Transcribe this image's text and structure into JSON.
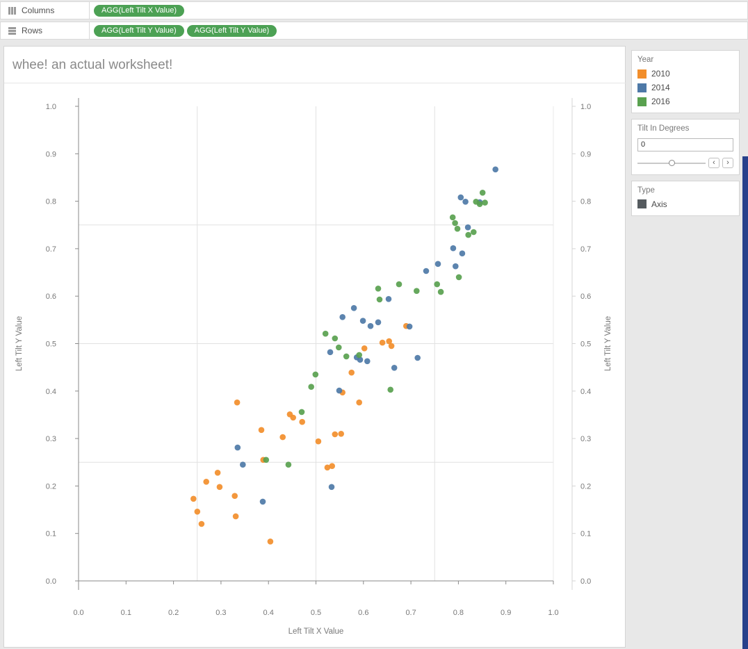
{
  "shelves": {
    "columns": {
      "label": "Columns",
      "pills": [
        "AGG(Left Tilt X Value)"
      ]
    },
    "rows": {
      "label": "Rows",
      "pills": [
        "AGG(Left Tilt Y Value)",
        "AGG(Left Tilt Y Value)"
      ]
    }
  },
  "worksheet": {
    "title": "whee! an actual worksheet!"
  },
  "cards": {
    "year": {
      "title": "Year",
      "items": [
        {
          "label": "2010",
          "color": "#f28e2b"
        },
        {
          "label": "2014",
          "color": "#4e79a7"
        },
        {
          "label": "2016",
          "color": "#59a14f"
        }
      ]
    },
    "tilt": {
      "title": "Tilt In Degrees",
      "value": "0",
      "prev_label": "‹",
      "next_label": "›"
    },
    "type": {
      "title": "Type",
      "items": [
        {
          "label": "Axis",
          "color": "#555b5f"
        }
      ]
    }
  },
  "chart_data": {
    "type": "scatter",
    "title": "whee! an actual worksheet!",
    "xlabel": "Left Tilt X Value",
    "ylabel": "Left Tilt Y Value",
    "ylabel_right": "Left Tilt Y Value",
    "xlim": [
      0.0,
      1.0
    ],
    "ylim": [
      0.0,
      1.0
    ],
    "x_ticks": [
      0.0,
      0.1,
      0.2,
      0.3,
      0.4,
      0.5,
      0.6,
      0.7,
      0.8,
      0.9,
      1.0
    ],
    "y_ticks": [
      0.0,
      0.1,
      0.2,
      0.3,
      0.4,
      0.5,
      0.6,
      0.7,
      0.8,
      0.9,
      1.0
    ],
    "grid_values": [
      0.25,
      0.5,
      0.75
    ],
    "legend_position": "right",
    "series": [
      {
        "name": "2010",
        "color": "#f28e2b",
        "points": [
          [
            0.242,
            0.173
          ],
          [
            0.25,
            0.146
          ],
          [
            0.259,
            0.12
          ],
          [
            0.269,
            0.209
          ],
          [
            0.293,
            0.228
          ],
          [
            0.297,
            0.198
          ],
          [
            0.329,
            0.179
          ],
          [
            0.331,
            0.136
          ],
          [
            0.334,
            0.376
          ],
          [
            0.385,
            0.318
          ],
          [
            0.389,
            0.255
          ],
          [
            0.404,
            0.083
          ],
          [
            0.43,
            0.303
          ],
          [
            0.445,
            0.351
          ],
          [
            0.452,
            0.344
          ],
          [
            0.471,
            0.335
          ],
          [
            0.505,
            0.294
          ],
          [
            0.524,
            0.239
          ],
          [
            0.534,
            0.242
          ],
          [
            0.54,
            0.309
          ],
          [
            0.553,
            0.31
          ],
          [
            0.556,
            0.397
          ],
          [
            0.575,
            0.439
          ],
          [
            0.591,
            0.376
          ],
          [
            0.602,
            0.49
          ],
          [
            0.64,
            0.502
          ],
          [
            0.654,
            0.505
          ],
          [
            0.659,
            0.495
          ],
          [
            0.69,
            0.537
          ]
        ]
      },
      {
        "name": "2014",
        "color": "#4e79a7",
        "points": [
          [
            0.335,
            0.281
          ],
          [
            0.346,
            0.245
          ],
          [
            0.388,
            0.167
          ],
          [
            0.533,
            0.198
          ],
          [
            0.53,
            0.482
          ],
          [
            0.549,
            0.401
          ],
          [
            0.556,
            0.556
          ],
          [
            0.58,
            0.575
          ],
          [
            0.586,
            0.471
          ],
          [
            0.593,
            0.466
          ],
          [
            0.599,
            0.548
          ],
          [
            0.608,
            0.463
          ],
          [
            0.615,
            0.537
          ],
          [
            0.631,
            0.545
          ],
          [
            0.653,
            0.594
          ],
          [
            0.665,
            0.449
          ],
          [
            0.697,
            0.536
          ],
          [
            0.714,
            0.47
          ],
          [
            0.732,
            0.653
          ],
          [
            0.757,
            0.668
          ],
          [
            0.789,
            0.701
          ],
          [
            0.794,
            0.663
          ],
          [
            0.808,
            0.69
          ],
          [
            0.805,
            0.808
          ],
          [
            0.815,
            0.799
          ],
          [
            0.82,
            0.745
          ],
          [
            0.845,
            0.798
          ],
          [
            0.878,
            0.867
          ]
        ]
      },
      {
        "name": "2016",
        "color": "#59a14f",
        "points": [
          [
            0.395,
            0.255
          ],
          [
            0.442,
            0.245
          ],
          [
            0.47,
            0.356
          ],
          [
            0.49,
            0.409
          ],
          [
            0.499,
            0.435
          ],
          [
            0.52,
            0.521
          ],
          [
            0.54,
            0.511
          ],
          [
            0.548,
            0.492
          ],
          [
            0.564,
            0.473
          ],
          [
            0.591,
            0.476
          ],
          [
            0.631,
            0.616
          ],
          [
            0.634,
            0.593
          ],
          [
            0.657,
            0.403
          ],
          [
            0.675,
            0.625
          ],
          [
            0.712,
            0.611
          ],
          [
            0.755,
            0.625
          ],
          [
            0.763,
            0.609
          ],
          [
            0.788,
            0.766
          ],
          [
            0.793,
            0.754
          ],
          [
            0.798,
            0.742
          ],
          [
            0.801,
            0.64
          ],
          [
            0.821,
            0.729
          ],
          [
            0.832,
            0.735
          ],
          [
            0.837,
            0.799
          ],
          [
            0.845,
            0.794
          ],
          [
            0.851,
            0.818
          ],
          [
            0.856,
            0.797
          ]
        ]
      }
    ]
  }
}
